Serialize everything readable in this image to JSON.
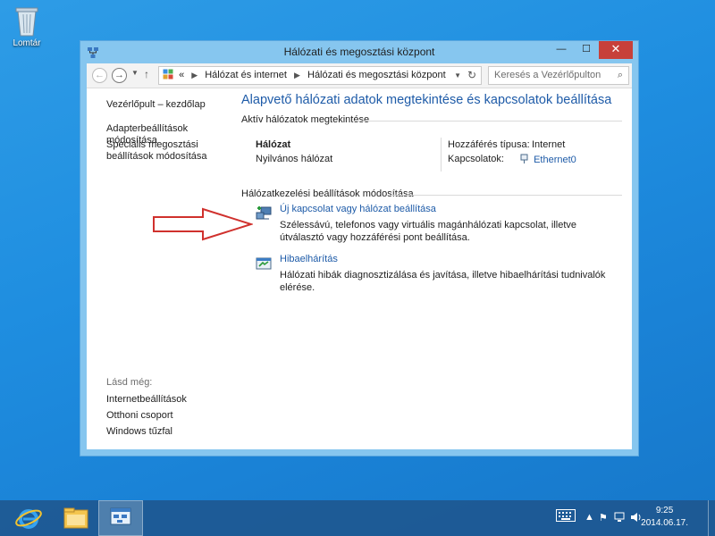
{
  "desktop": {
    "recycle_bin_label": "Lomtár"
  },
  "window": {
    "title": "Hálózati és megosztási központ",
    "minimize_label": "—",
    "maximize_label": "☐",
    "close_label": "✕"
  },
  "address": {
    "back_label": "←",
    "forward_label": "→",
    "up_label": "↑",
    "chevron": "«",
    "crumb1": "Hálózat és internet",
    "crumb2": "Hálózati és megosztási központ",
    "separator": "▶",
    "search_placeholder": "Keresés a Vezérlőpulton",
    "refresh_label": "↻",
    "search_icon_label": "⌕"
  },
  "sidebar": {
    "home": "Vezérlőpult – kezdőlap",
    "adapter": "Adapterbeállítások módosítása",
    "sharing_line1": "Speciális megosztási",
    "sharing_line2": "beállítások módosítása",
    "see_also": "Lásd még:",
    "internet_options": "Internetbeállítások",
    "homegroup": "Otthoni csoport",
    "firewall": "Windows tűzfal"
  },
  "main": {
    "heading": "Alapvető hálózati adatok megtekintése és kapcsolatok beállítása",
    "active_networks_heading": "Aktív hálózatok megtekintése",
    "network_name": "Hálózat",
    "network_type": "Nyilvános hálózat",
    "access_type_label": "Hozzáférés típusa:",
    "access_type_value": "Internet",
    "connections_label": "Kapcsolatok:",
    "connections_value": "Ethernet0",
    "change_settings_heading": "Hálózatkezelési beállítások módosítása",
    "task1_title": "Új kapcsolat vagy hálózat beállítása",
    "task1_desc": "Szélessávú, telefonos vagy virtuális magánhálózati kapcsolat, illetve útválasztó vagy hozzáférési pont beállítása.",
    "task2_title": "Hibaelhárítás",
    "task2_desc": "Hálózati hibák diagnosztizálása és javítása, illetve hibaelhárítási tudnivalók elérése."
  },
  "taskbar": {
    "time": "9:25",
    "date": "2014.06.17."
  },
  "colors": {
    "link": "#1e5ba8",
    "window_frame": "#86c6ef",
    "close_button": "#c7403a",
    "annotation_arrow": "#d0312d"
  }
}
